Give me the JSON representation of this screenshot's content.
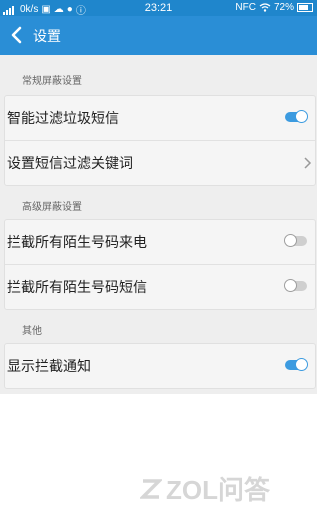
{
  "status_bar": {
    "network_speed": "0k/s",
    "time": "23:21",
    "nfc": "NFC",
    "battery_percent": "72%",
    "battery_level": 0.72
  },
  "toolbar": {
    "title": "设置"
  },
  "sections": {
    "general": "常规屏蔽设置",
    "advanced": "高级屏蔽设置",
    "other": "其他"
  },
  "settings": {
    "smart_filter_label": "智能过滤垃圾短信",
    "smart_filter_on": true,
    "keywords_label": "设置短信过滤关键词",
    "block_calls_label": "拦截所有陌生号码来电",
    "block_calls_on": false,
    "block_sms_label": "拦截所有陌生号码短信",
    "block_sms_on": false,
    "show_notify_label": "显示拦截通知",
    "show_notify_on": true
  },
  "watermark": {
    "text": "ZOL问答"
  }
}
